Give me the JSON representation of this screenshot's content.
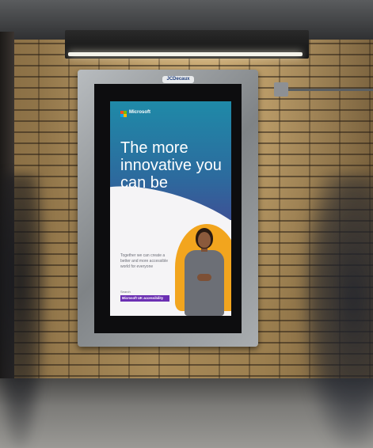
{
  "billboard": {
    "frame_label": "JCDecaux",
    "ad": {
      "brand": "Microsoft",
      "headline": "The more innovative you can be",
      "body": "Together we can create a better and more accessible world for everyone",
      "search_label": "Search",
      "search_query": "Microsoft UK accessibility"
    }
  },
  "colors": {
    "ms_red": "#f25022",
    "ms_green": "#7fba00",
    "ms_blue": "#00a4ef",
    "ms_yellow": "#ffb900",
    "ad_accent_purple": "#6b2fb3",
    "ad_accent_orange": "#f2a51e"
  }
}
